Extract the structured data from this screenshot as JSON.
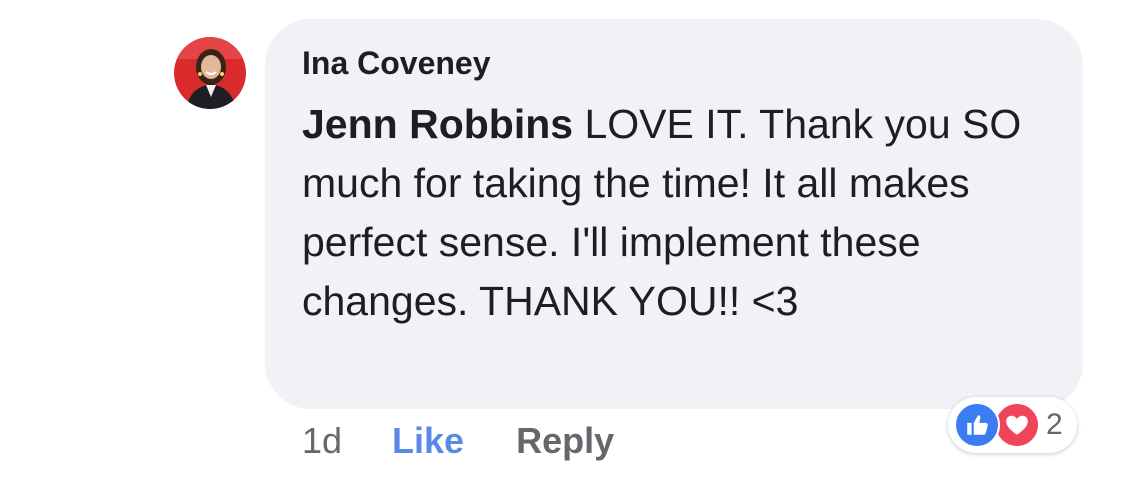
{
  "comment": {
    "author": "Ina Coveney",
    "mention": "Jenn Robbins",
    "text": " LOVE IT. Thank you SO much for taking the time! It all makes perfect sense. I'll implement these changes. THANK YOU!! <3",
    "time": "1d",
    "like_label": "Like",
    "reply_label": "Reply"
  },
  "reactions": {
    "types": [
      "like-icon",
      "love-icon"
    ],
    "count": "2"
  },
  "colors": {
    "bubble": "#f0f2f5",
    "like_link": "#5b89e6",
    "like_reaction": "#3b7cf2",
    "love_reaction": "#f0445a",
    "avatar_bg": "#d92b2b"
  }
}
